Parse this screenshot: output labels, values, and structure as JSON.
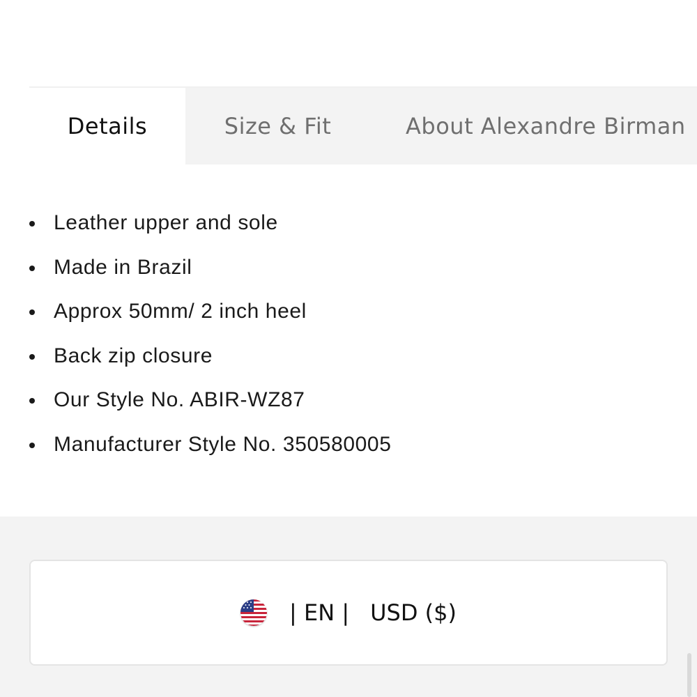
{
  "tabs": [
    {
      "label": "Details",
      "active": true
    },
    {
      "label": "Size & Fit",
      "active": false
    },
    {
      "label": "About Alexandre Birman",
      "active": false
    }
  ],
  "details": [
    "Leather upper and sole",
    "Made in Brazil",
    "Approx 50mm/ 2 inch heel",
    "Back zip closure",
    "Our Style No. ABIR-WZ87",
    "Manufacturer Style No. 350580005"
  ],
  "locale": {
    "flag": "us-flag-icon",
    "language": "| EN |",
    "currency": "USD ($)"
  },
  "colors": {
    "tab_bar_bg": "#f3f3f3",
    "footer_bg": "#f3f3f3",
    "text": "#1a1a1a",
    "inactive_tab_text": "#6f6f6f"
  }
}
